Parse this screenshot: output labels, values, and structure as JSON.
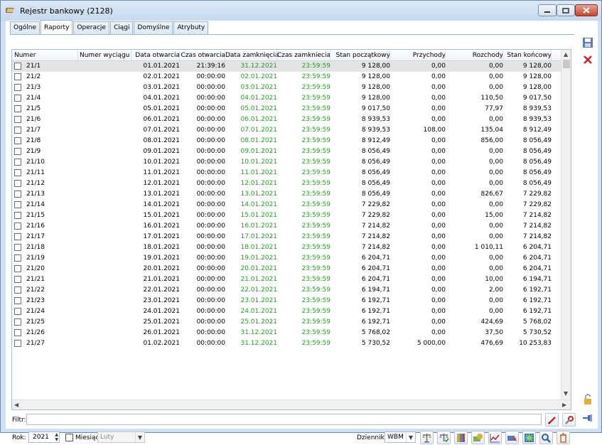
{
  "window": {
    "title": "Rejestr bankowy (2128)"
  },
  "tabs": [
    {
      "label": "Ogólne",
      "active": false
    },
    {
      "label": "Raporty",
      "active": true
    },
    {
      "label": "Operacje",
      "active": false
    },
    {
      "label": "Ciągi",
      "active": false
    },
    {
      "label": "Domyślne",
      "active": false
    },
    {
      "label": "Atrybuty",
      "active": false
    }
  ],
  "table": {
    "columns": [
      "Numer",
      "Numer wyciągu",
      "Data otwarcia",
      "Czas otwarcia",
      "Data zamknięcia",
      "Czas zamkniecia",
      "Stan początkowy",
      "Przychody",
      "Rozchody",
      "Stan końcowy"
    ],
    "rows": [
      [
        "21/1",
        "",
        "01.01.2021",
        "21:39:16",
        "31.12.2021",
        "23:59:59",
        "9 128,00",
        "0,00",
        "0,00",
        "9 128,00"
      ],
      [
        "21/2",
        "",
        "02.01.2021",
        "00:00:00",
        "02.01.2021",
        "23:59:59",
        "9 128,00",
        "0,00",
        "0,00",
        "9 128,00"
      ],
      [
        "21/3",
        "",
        "03.01.2021",
        "00:00:00",
        "03.01.2021",
        "23:59:59",
        "9 128,00",
        "0,00",
        "0,00",
        "9 128,00"
      ],
      [
        "21/4",
        "",
        "04.01.2021",
        "00:00:00",
        "04.01.2021",
        "23:59:59",
        "9 128,00",
        "0,00",
        "110,50",
        "9 017,50"
      ],
      [
        "21/5",
        "",
        "05.01.2021",
        "00:00:00",
        "05.01.2021",
        "23:59:59",
        "9 017,50",
        "0,00",
        "77,97",
        "8 939,53"
      ],
      [
        "21/6",
        "",
        "06.01.2021",
        "00:00:00",
        "06.01.2021",
        "23:59:59",
        "8 939,53",
        "0,00",
        "0,00",
        "8 939,53"
      ],
      [
        "21/7",
        "",
        "07.01.2021",
        "00:00:00",
        "07.01.2021",
        "23:59:59",
        "8 939,53",
        "108,00",
        "135,04",
        "8 912,49"
      ],
      [
        "21/8",
        "",
        "08.01.2021",
        "00:00:00",
        "08.01.2021",
        "23:59:59",
        "8 912,49",
        "0,00",
        "856,00",
        "8 056,49"
      ],
      [
        "21/9",
        "",
        "09.01.2021",
        "00:00:00",
        "09.01.2021",
        "23:59:59",
        "8 056,49",
        "0,00",
        "0,00",
        "8 056,49"
      ],
      [
        "21/10",
        "",
        "10.01.2021",
        "00:00:00",
        "10.01.2021",
        "23:59:59",
        "8 056,49",
        "0,00",
        "0,00",
        "8 056,49"
      ],
      [
        "21/11",
        "",
        "11.01.2021",
        "00:00:00",
        "11.01.2021",
        "23:59:59",
        "8 056,49",
        "0,00",
        "0,00",
        "8 056,49"
      ],
      [
        "21/12",
        "",
        "12.01.2021",
        "00:00:00",
        "12.01.2021",
        "23:59:59",
        "8 056,49",
        "0,00",
        "0,00",
        "8 056,49"
      ],
      [
        "21/13",
        "",
        "13.01.2021",
        "00:00:00",
        "13.01.2021",
        "23:59:59",
        "8 056,49",
        "0,00",
        "826,67",
        "7 229,82"
      ],
      [
        "21/14",
        "",
        "14.01.2021",
        "00:00:00",
        "14.01.2021",
        "23:59:59",
        "7 229,82",
        "0,00",
        "0,00",
        "7 229,82"
      ],
      [
        "21/15",
        "",
        "15.01.2021",
        "00:00:00",
        "15.01.2021",
        "23:59:59",
        "7 229,82",
        "0,00",
        "15,00",
        "7 214,82"
      ],
      [
        "21/16",
        "",
        "16.01.2021",
        "00:00:00",
        "16.01.2021",
        "23:59:59",
        "7 214,82",
        "0,00",
        "0,00",
        "7 214,82"
      ],
      [
        "21/17",
        "",
        "17.01.2021",
        "00:00:00",
        "17.01.2021",
        "23:59:59",
        "7 214,82",
        "0,00",
        "0,00",
        "7 214,82"
      ],
      [
        "21/18",
        "",
        "18.01.2021",
        "00:00:00",
        "18.01.2021",
        "23:59:59",
        "7 214,82",
        "0,00",
        "1 010,11",
        "6 204,71"
      ],
      [
        "21/19",
        "",
        "19.01.2021",
        "00:00:00",
        "19.01.2021",
        "23:59:59",
        "6 204,71",
        "0,00",
        "0,00",
        "6 204,71"
      ],
      [
        "21/20",
        "",
        "20.01.2021",
        "00:00:00",
        "20.01.2021",
        "23:59:59",
        "6 204,71",
        "0,00",
        "0,00",
        "6 204,71"
      ],
      [
        "21/21",
        "",
        "21.01.2021",
        "00:00:00",
        "21.01.2021",
        "23:59:59",
        "6 204,71",
        "0,00",
        "10,00",
        "6 194,71"
      ],
      [
        "21/22",
        "",
        "22.01.2021",
        "00:00:00",
        "22.01.2021",
        "23:59:59",
        "6 194,71",
        "0,00",
        "2,00",
        "6 192,71"
      ],
      [
        "21/23",
        "",
        "23.01.2021",
        "00:00:00",
        "23.01.2021",
        "23:59:59",
        "6 192,71",
        "0,00",
        "0,00",
        "6 192,71"
      ],
      [
        "21/24",
        "",
        "24.01.2021",
        "00:00:00",
        "24.01.2021",
        "23:59:59",
        "6 192,71",
        "0,00",
        "0,00",
        "6 192,71"
      ],
      [
        "21/25",
        "",
        "25.01.2021",
        "00:00:00",
        "25.01.2021",
        "23:59:59",
        "6 192,71",
        "0,00",
        "424,69",
        "5 768,02"
      ],
      [
        "21/26",
        "",
        "26.01.2021",
        "00:00:00",
        "31.12.2021",
        "23:59:59",
        "5 768,02",
        "0,00",
        "37,50",
        "5 730,52"
      ],
      [
        "21/27",
        "",
        "01.02.2021",
        "00:00:00",
        "31.12.2021",
        "23:59:59",
        "5 730,52",
        "5 000,00",
        "476,69",
        "10 253,83"
      ]
    ]
  },
  "filter": {
    "label": "Filtr:",
    "value": ""
  },
  "year": {
    "label": "Rok:",
    "value": "2021"
  },
  "month": {
    "label": "Miesiąc:",
    "value": "Luty",
    "checked": false
  },
  "journal": {
    "label": "Dziennik:",
    "value": "WBM"
  },
  "colors": {
    "green_text": "#1fa01f",
    "selected_row": "#e4e4e4",
    "frame": "#cfe0f3"
  }
}
